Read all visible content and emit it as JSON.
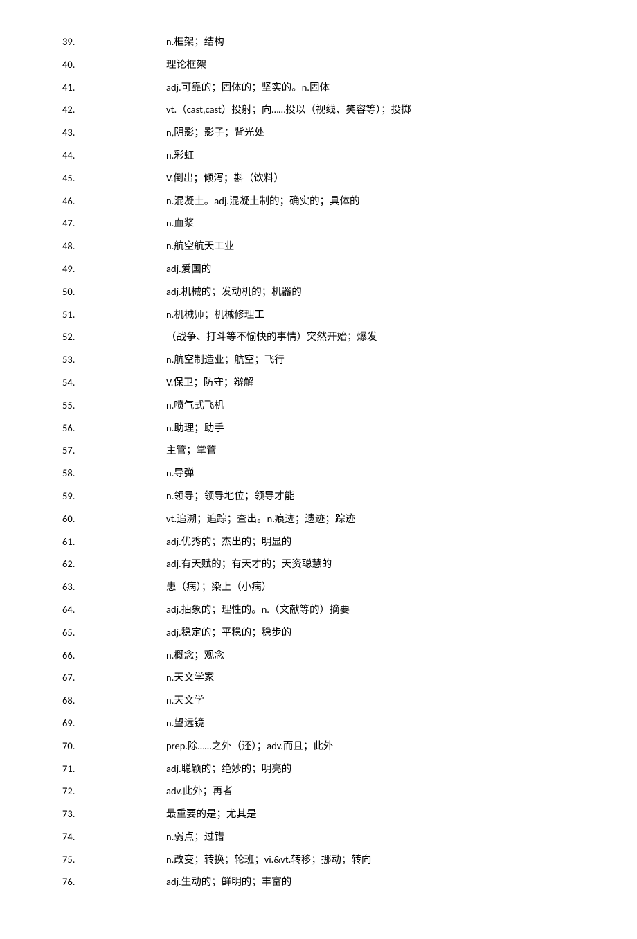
{
  "rows": [
    {
      "num": "39.",
      "def": "n.框架；结构"
    },
    {
      "num": "40.",
      "def": "理论框架"
    },
    {
      "num": "41.",
      "def": "adj.可靠的；固体的；坚实的。n.固体"
    },
    {
      "num": "42.",
      "def": "vt.（cast,cast）投射；向……投以（视线、笑容等）；投掷"
    },
    {
      "num": "43.",
      "def": "n,阴影；影子；背光处"
    },
    {
      "num": "44.",
      "def": "n.彩虹"
    },
    {
      "num": "45.",
      "def": "V.倒出；倾泻；斟（饮料）"
    },
    {
      "num": "46.",
      "def": "n.混凝土。adj.混凝土制的；确实的；具体的"
    },
    {
      "num": "47.",
      "def": "n.血浆"
    },
    {
      "num": "48.",
      "def": "n.航空航天工业"
    },
    {
      "num": "49.",
      "def": "adj.爱国的"
    },
    {
      "num": "50.",
      "def": "adj.机械的；发动机的；机器的"
    },
    {
      "num": "51.",
      "def": "n.机械师；机械修理工"
    },
    {
      "num": "52.",
      "def": "（战争、打斗等不愉快的事情）突然开始；爆发"
    },
    {
      "num": "53.",
      "def": "n.航空制造业；航空；飞行"
    },
    {
      "num": "54.",
      "def": "V.保卫；防守；辩解"
    },
    {
      "num": "55.",
      "def": "n.喷气式飞机"
    },
    {
      "num": "56.",
      "def": "n.助理；助手"
    },
    {
      "num": "57.",
      "def": "主管；掌管"
    },
    {
      "num": "58.",
      "def": "n.导弹"
    },
    {
      "num": "59.",
      "def": "n.领导；领导地位；领导才能"
    },
    {
      "num": "60.",
      "def": "vt.追溯；追踪；查出。n.痕迹；遗迹；踪迹"
    },
    {
      "num": "61.",
      "def": "adj.优秀的；杰出的；明显的"
    },
    {
      "num": "62.",
      "def": "adj.有天赋的；有天才的；天资聪慧的"
    },
    {
      "num": "63.",
      "def": "患（病）；染上（小病）"
    },
    {
      "num": "64.",
      "def": "adj.抽象的；理性的。n.（文献等的）摘要"
    },
    {
      "num": "65.",
      "def": "adj.稳定的；平稳的；稳步的"
    },
    {
      "num": "66.",
      "def": "n.概念；观念"
    },
    {
      "num": "67.",
      "def": "n.天文学家"
    },
    {
      "num": "68.",
      "def": "n.天文学"
    },
    {
      "num": "69.",
      "def": "n.望远镜"
    },
    {
      "num": "70.",
      "def": "prep.除……之外（还）；adv.而且；此外"
    },
    {
      "num": "71.",
      "def": "adj.聪颖的；绝妙的；明亮的"
    },
    {
      "num": "72.",
      "def": "adv.此外；再者"
    },
    {
      "num": "73.",
      "def": "最重要的是；尤其是"
    },
    {
      "num": "74.",
      "def": "n.弱点；过错"
    },
    {
      "num": "75.",
      "def": "n.改变；转换；轮班；vi.&vt.转移；挪动；转向"
    },
    {
      "num": "76.",
      "def": "adj.生动的；鲜明的；丰富的"
    }
  ]
}
